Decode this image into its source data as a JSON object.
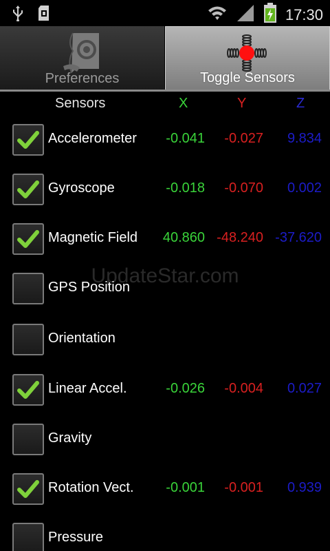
{
  "status_bar": {
    "time": "17:30",
    "icons": [
      "usb-icon",
      "sd-card-icon",
      "wifi-icon",
      "signal-icon",
      "battery-charging-icon"
    ]
  },
  "tabs": [
    {
      "label": "Preferences",
      "icon": "preferences-icon",
      "selected": false
    },
    {
      "label": "Toggle Sensors",
      "icon": "toggle-sensors-icon",
      "selected": true
    }
  ],
  "header": {
    "sensors": "Sensors",
    "x": "X",
    "y": "Y",
    "z": "Z"
  },
  "colors": {
    "x": "#3ad43a",
    "y": "#d82020",
    "z": "#1c1cc8",
    "check": "#7fd13b"
  },
  "watermark": "UpdateStar.com",
  "sensors": [
    {
      "label": "Accelerometer",
      "checked": true,
      "x": "-0.041",
      "y": "-0.027",
      "z": "9.834"
    },
    {
      "label": "Gyroscope",
      "checked": true,
      "x": "-0.018",
      "y": "-0.070",
      "z": "0.002"
    },
    {
      "label": "Magnetic Field",
      "checked": true,
      "x": "40.860",
      "y": "-48.240",
      "z": "-37.620"
    },
    {
      "label": "GPS Position",
      "checked": false,
      "x": "",
      "y": "",
      "z": ""
    },
    {
      "label": "Orientation",
      "checked": false,
      "x": "",
      "y": "",
      "z": ""
    },
    {
      "label": "Linear Accel.",
      "checked": true,
      "x": "-0.026",
      "y": "-0.004",
      "z": "0.027"
    },
    {
      "label": "Gravity",
      "checked": false,
      "x": "",
      "y": "",
      "z": ""
    },
    {
      "label": "Rotation Vect.",
      "checked": true,
      "x": "-0.001",
      "y": "-0.001",
      "z": "0.939"
    },
    {
      "label": "Pressure",
      "checked": false,
      "x": "",
      "y": "",
      "z": ""
    }
  ]
}
